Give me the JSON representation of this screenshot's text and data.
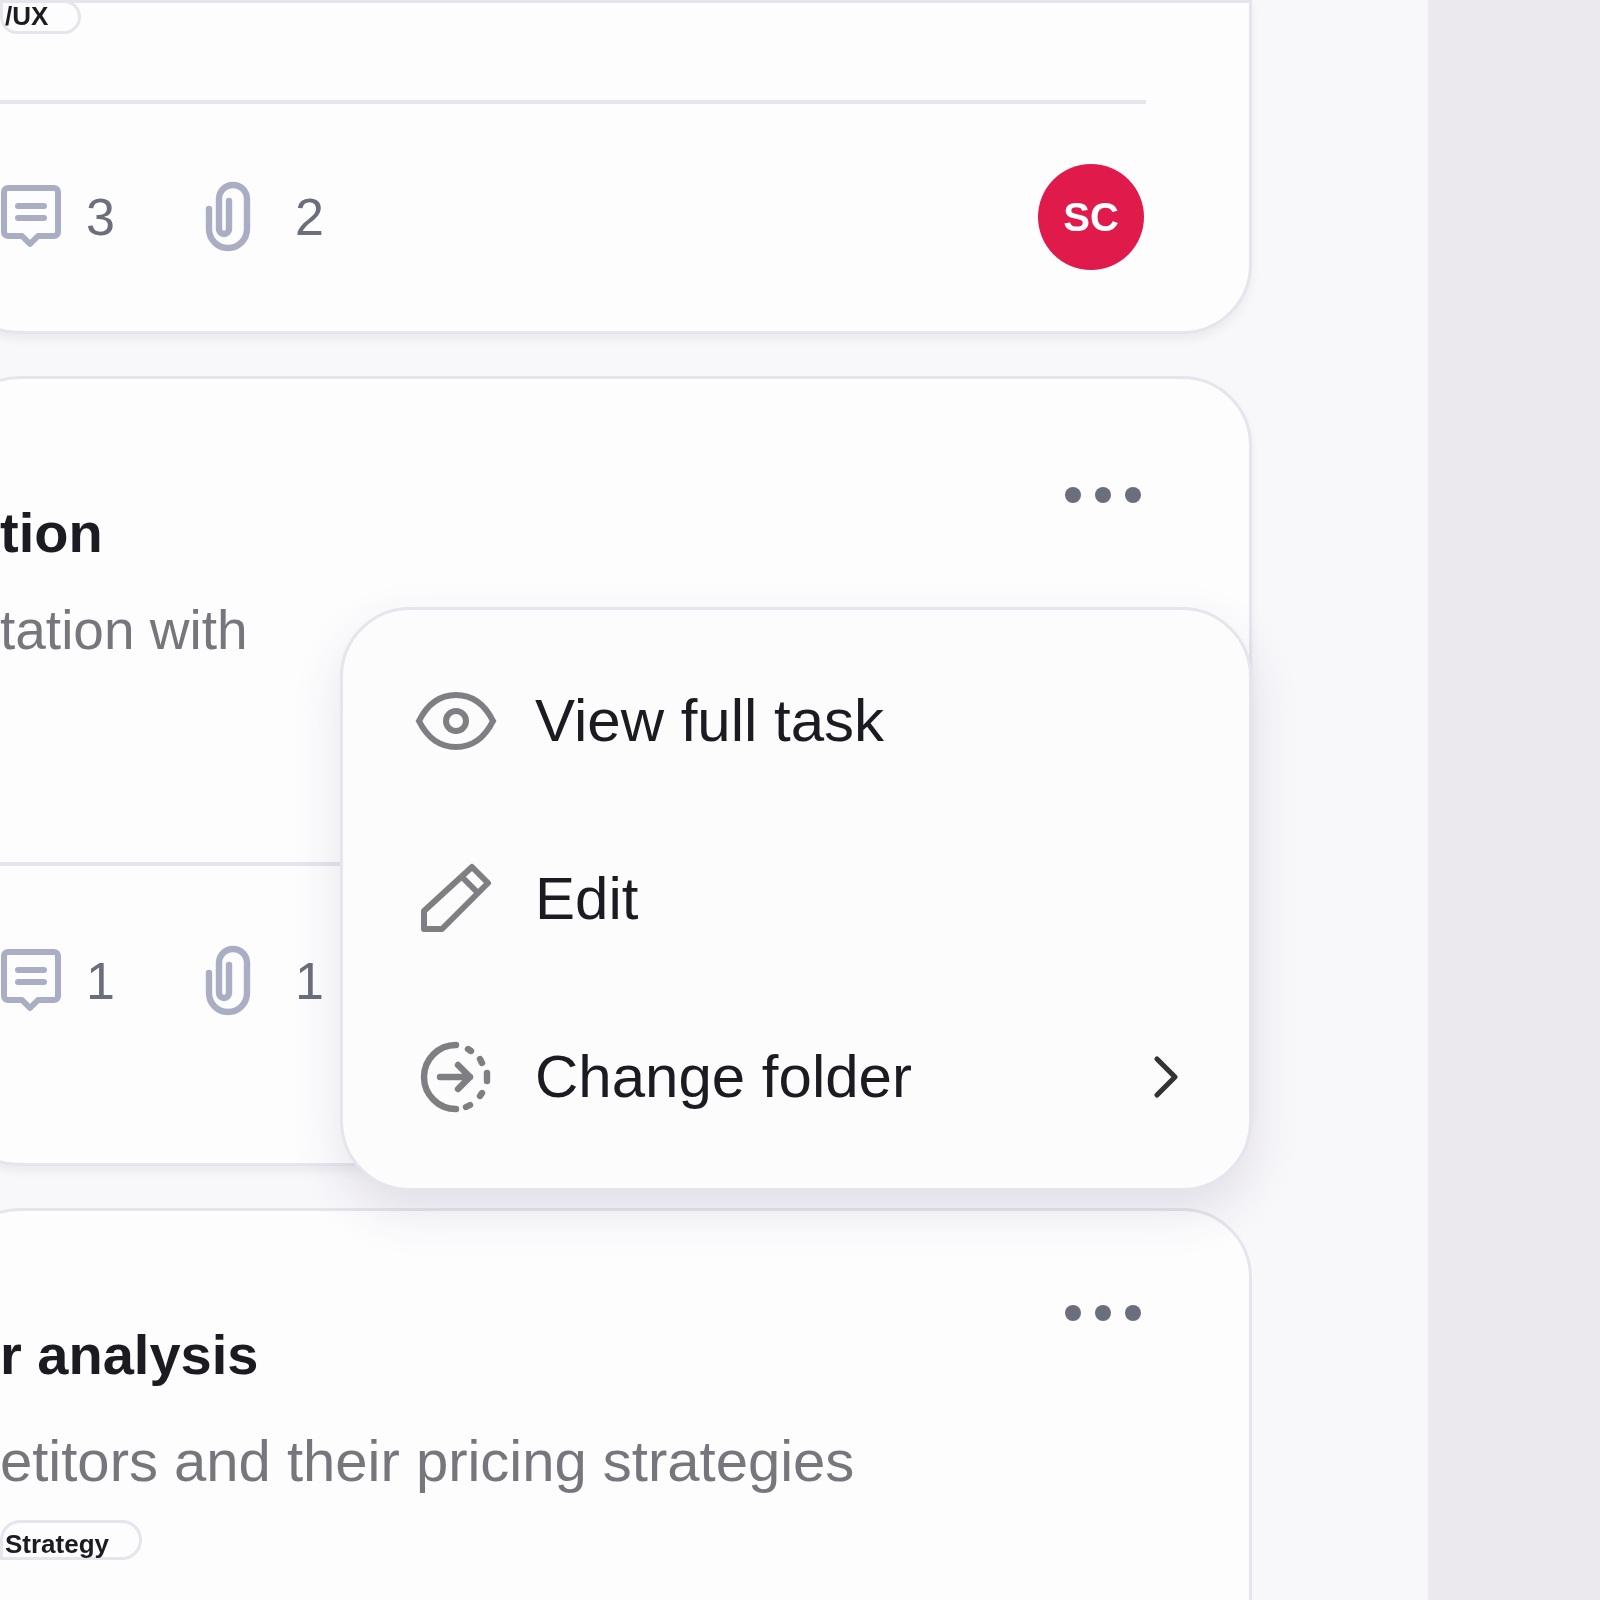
{
  "cards": [
    {
      "tag": "/UX",
      "comments": "3",
      "attachments": "2",
      "avatar": "SC"
    },
    {
      "title": "tion",
      "description": "tation with",
      "comments": "1",
      "attachments": "1",
      "menu_open": true
    },
    {
      "title": "r analysis",
      "description": "etitors and their pricing strategies",
      "tag": "Strategy"
    }
  ],
  "menu": {
    "items": [
      {
        "kind": "view",
        "label": "View full task",
        "has_submenu": false
      },
      {
        "kind": "edit",
        "label": "Edit",
        "has_submenu": false
      },
      {
        "kind": "move",
        "label": "Change folder",
        "has_submenu": true
      }
    ]
  }
}
